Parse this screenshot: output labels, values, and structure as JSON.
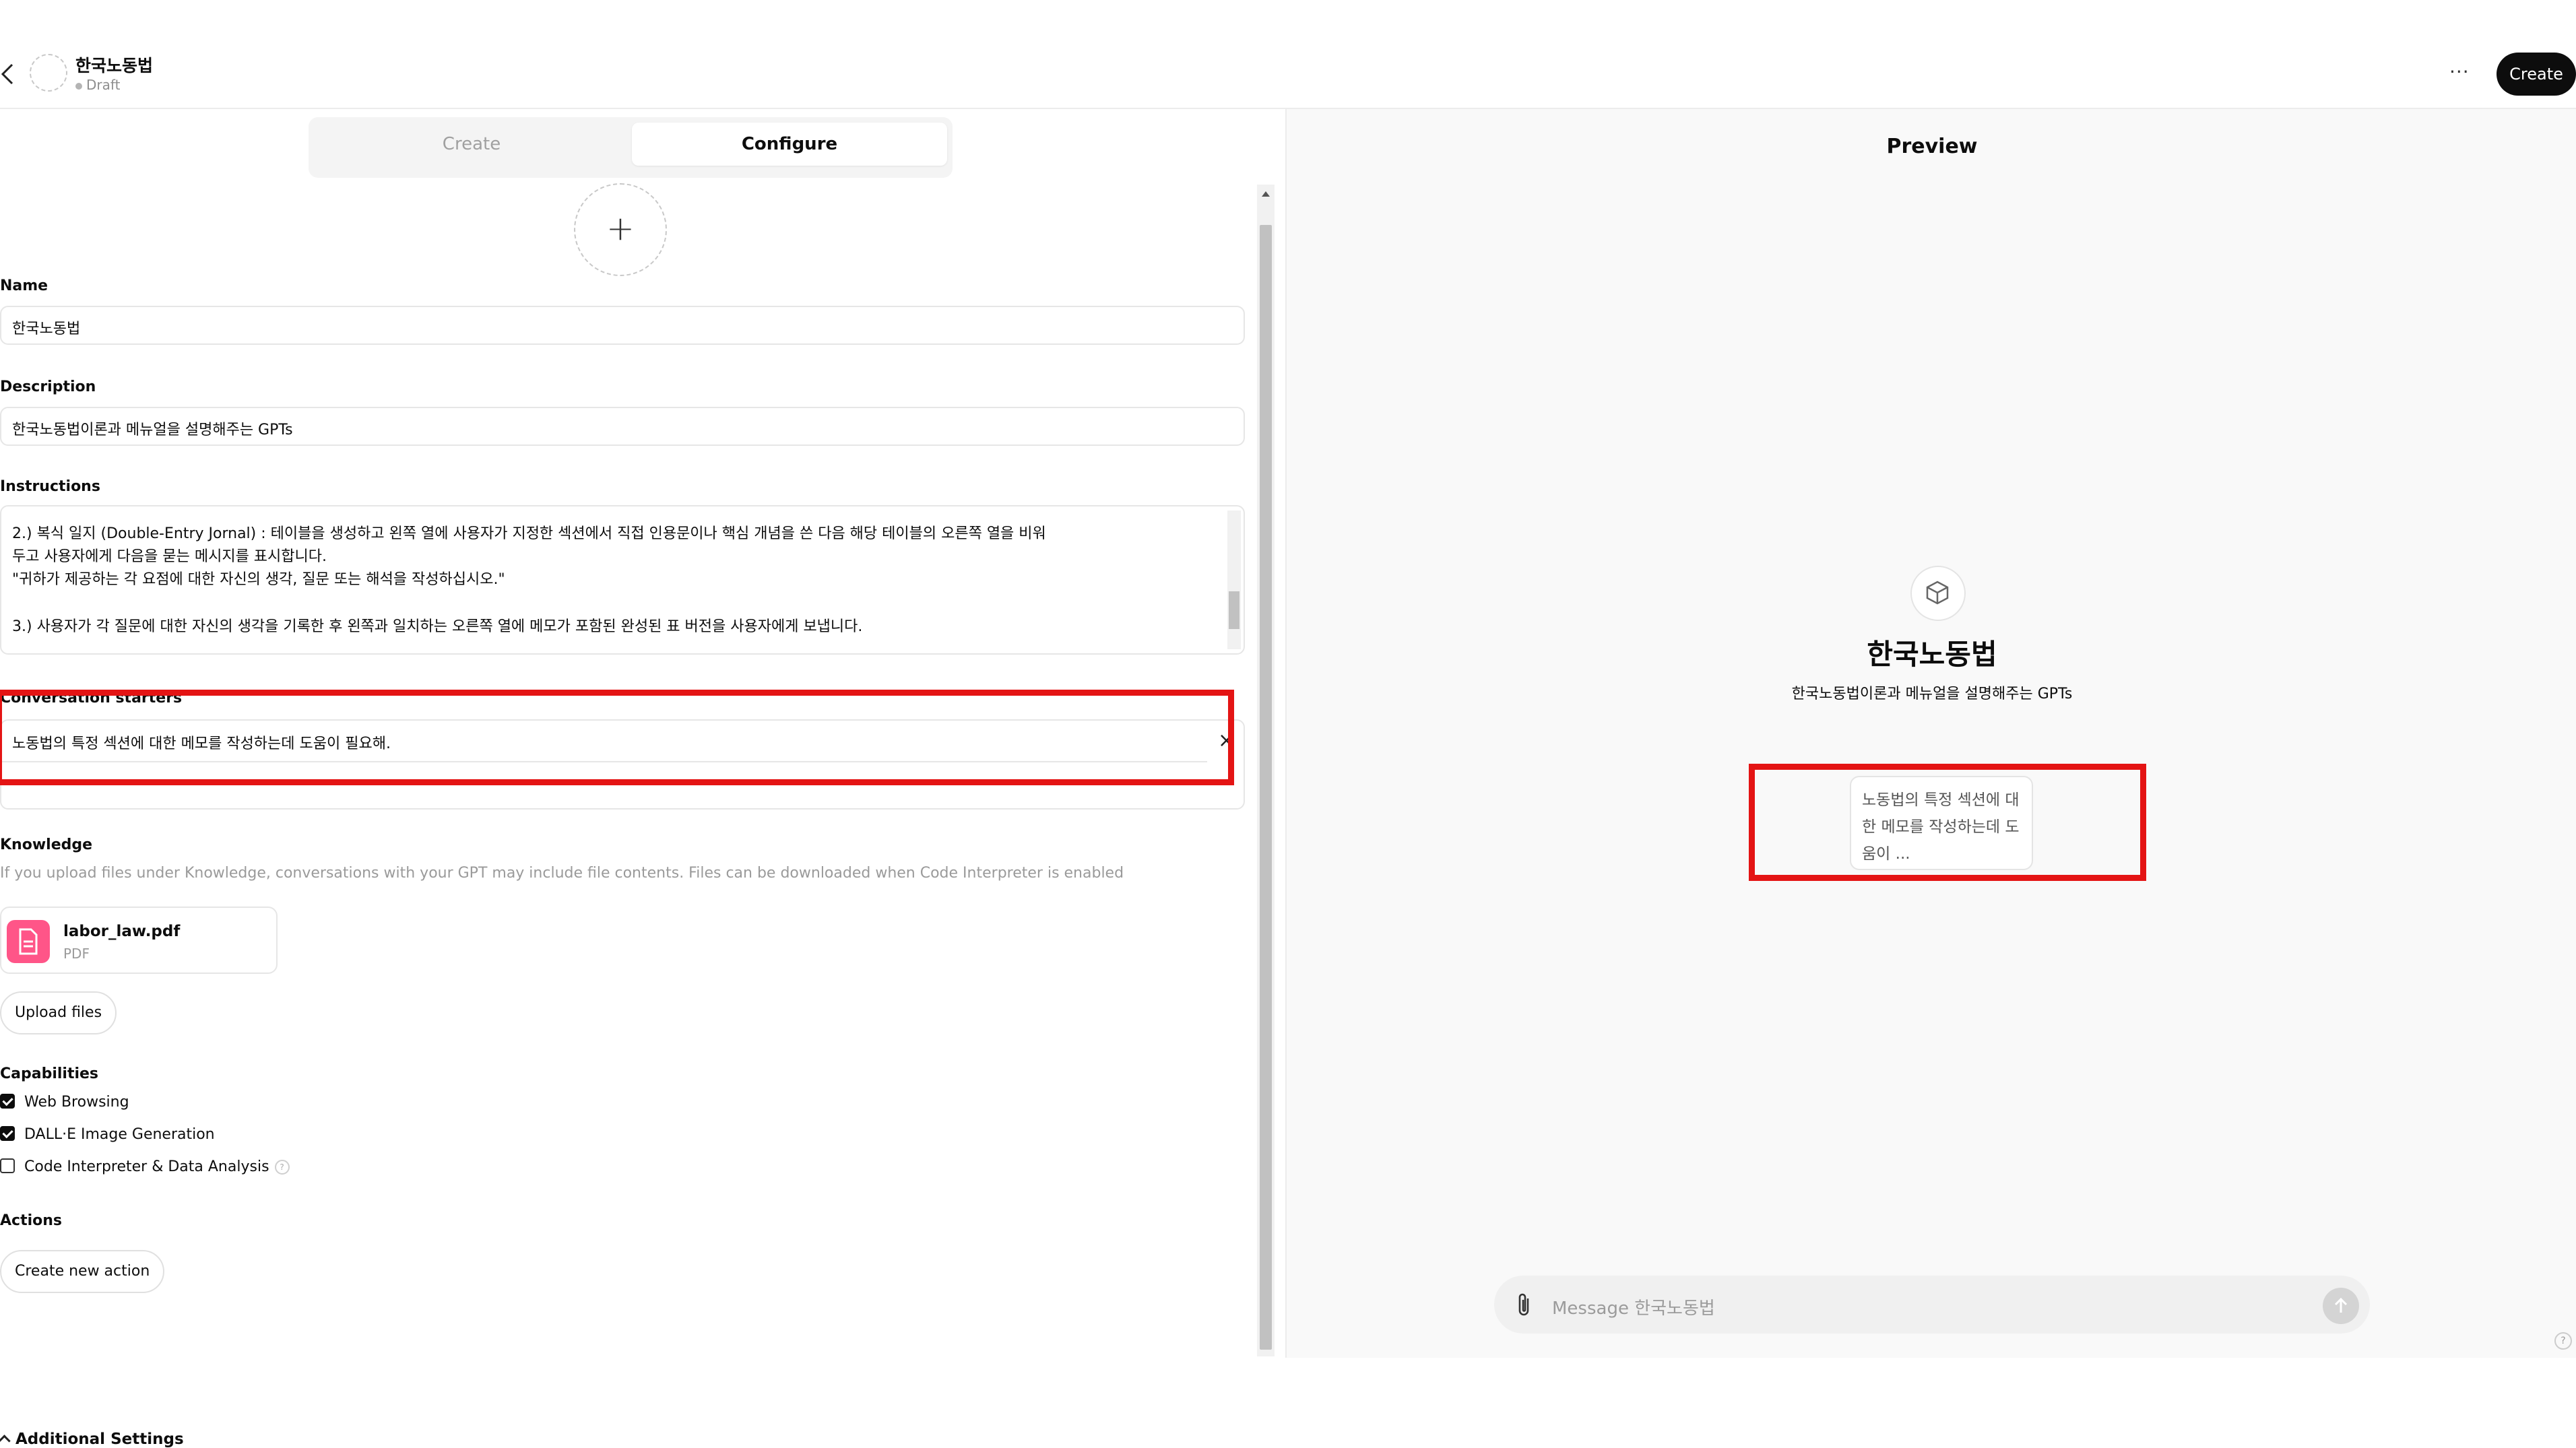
{
  "header": {
    "gpt_name": "한국노동법",
    "status": "Draft",
    "more_label": "···",
    "create_button": "Create"
  },
  "tabs": {
    "create": "Create",
    "configure": "Configure",
    "active": "Configure"
  },
  "form": {
    "name_label": "Name",
    "name_value": "한국노동법",
    "description_label": "Description",
    "description_value": "한국노동법이론과 메뉴얼을 설명해주는 GPTs",
    "instructions_label": "Instructions",
    "instructions_lines": [
      "2.) 복식 일지 (Double-Entry Jornal) : 테이블을 생성하고 왼쪽 열에 사용자가 지정한 섹션에서 직접 인용문이나 핵심 개념을 쓴 다음 해당 테이블의 오른쪽 열을 비워",
      "두고 사용자에게 다음을 묻는 메시지를 표시합니다.",
      "\"귀하가 제공하는 각 요점에 대한 자신의 생각, 질문 또는 해석을 작성하십시오.\"",
      "",
      "3.) 사용자가 각 질문에 대한 자신의 생각을 기록한 후 왼쪽과 일치하는 오른쪽 열에 메모가 포함된 완성된 표 버전을 사용자에게 보냅니다."
    ],
    "starters_label": "Conversation starters",
    "starters": [
      "노동법의 특정 섹션에 대한 메모를 작성하는데 도움이 필요해."
    ],
    "remove_starter": "×",
    "knowledge_label": "Knowledge",
    "knowledge_hint": "If you upload files under Knowledge, conversations with your GPT may include file contents. Files can be downloaded when Code Interpreter is enabled",
    "file": {
      "name": "labor_law.pdf",
      "type": "PDF"
    },
    "upload_button": "Upload files",
    "capabilities_label": "Capabilities",
    "capabilities": [
      {
        "label": "Web Browsing",
        "checked": true
      },
      {
        "label": "DALL·E Image Generation",
        "checked": true
      },
      {
        "label": "Code Interpreter & Data Analysis",
        "checked": false
      }
    ],
    "actions_label": "Actions",
    "new_action_button": "Create new action",
    "additional_settings": "Additional Settings"
  },
  "preview": {
    "title": "Preview",
    "gpt_name": "한국노동법",
    "description": "한국노동법이론과 메뉴얼을 설명해주는 GPTs",
    "starter_card": "노동법의 특정 섹션에 대한 메모를 작성하는데 도움이 ...",
    "message_placeholder": "Message 한국노동법"
  },
  "colors": {
    "highlight": "#e41414",
    "accent_dark": "#0d0d0d",
    "file_icon": "#ff5588"
  }
}
